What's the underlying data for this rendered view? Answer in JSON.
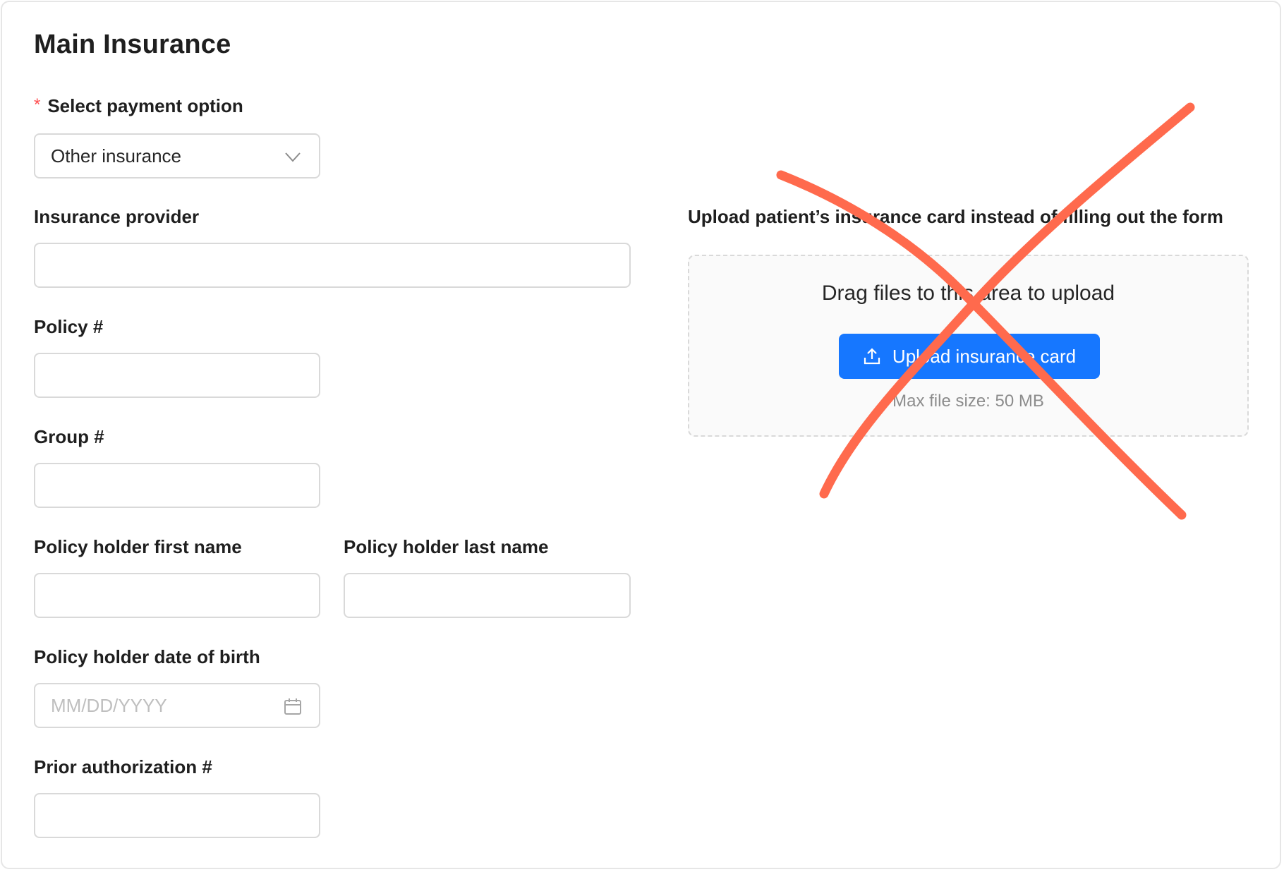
{
  "form": {
    "title": "Main Insurance",
    "payment_option": {
      "required_marker": "*",
      "label": "Select payment option",
      "value": "Other insurance"
    },
    "insurance_provider": {
      "label": "Insurance provider",
      "value": ""
    },
    "policy": {
      "label": "Policy #",
      "value": ""
    },
    "group": {
      "label": "Group #",
      "value": ""
    },
    "holder_first_name": {
      "label": "Policy holder first name",
      "value": ""
    },
    "holder_last_name": {
      "label": "Policy holder last name",
      "value": ""
    },
    "holder_dob": {
      "label": "Policy holder date of birth",
      "placeholder": "MM/DD/YYYY"
    },
    "prior_auth": {
      "label": "Prior authorization #",
      "value": ""
    }
  },
  "upload": {
    "label": "Upload patient’s insurance card instead of filling out the form",
    "drag_text": "Drag files to this area to upload",
    "button_label": "Upload insurance card",
    "max_size": "Max file size: 50 MB"
  },
  "icons": {
    "select": "chevron-down-icon",
    "date": "calendar-icon",
    "upload": "upload-icon"
  },
  "colors": {
    "primary": "#1677ff",
    "required": "#ff4d4f",
    "cross_out": "#ff6a4d"
  }
}
